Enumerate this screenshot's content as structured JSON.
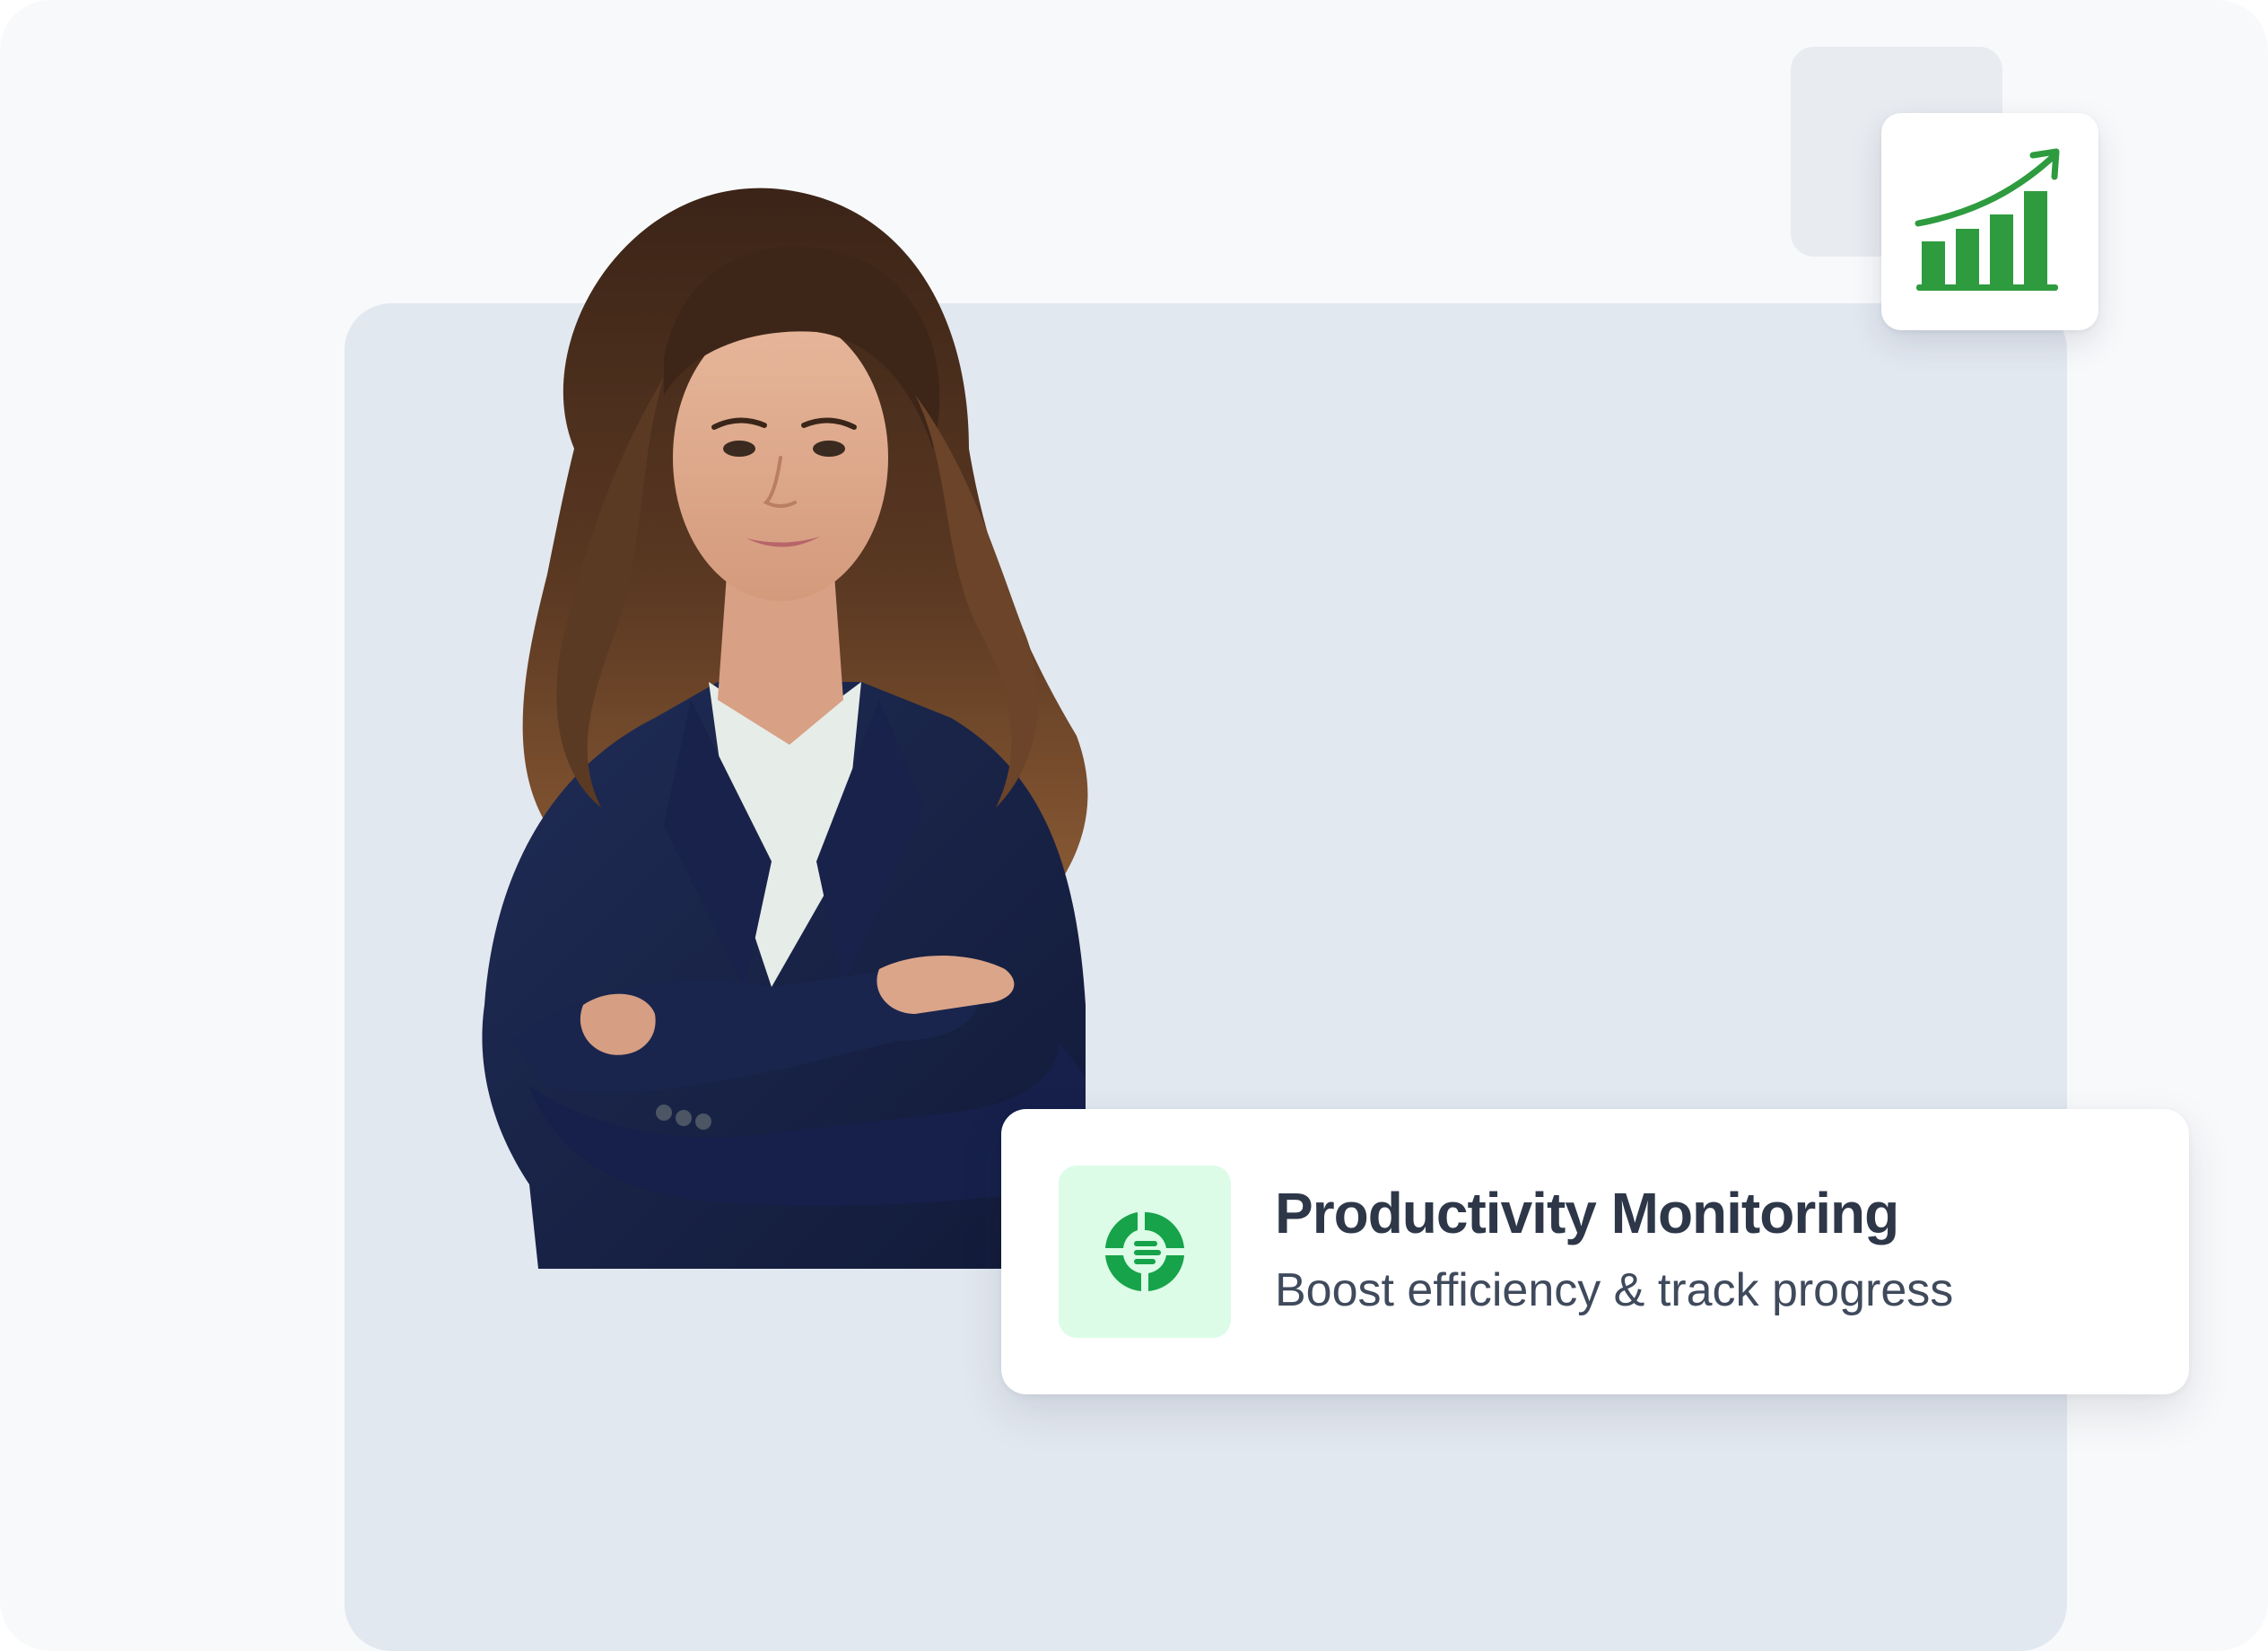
{
  "feature_card": {
    "title": "Productivity Monitoring",
    "subtitle": "Boost efficiency & track progress",
    "icon": "donut-list-icon"
  },
  "chart_badge": {
    "icon": "growth-chart-icon"
  },
  "photo": {
    "subject": "portrait-photo"
  },
  "colors": {
    "accent_green": "#16a34a",
    "icon_bg": "#dcfce7",
    "backdrop": "#e2e8f0",
    "page_bg": "#f8f9fb",
    "title_text": "#2d3748"
  }
}
